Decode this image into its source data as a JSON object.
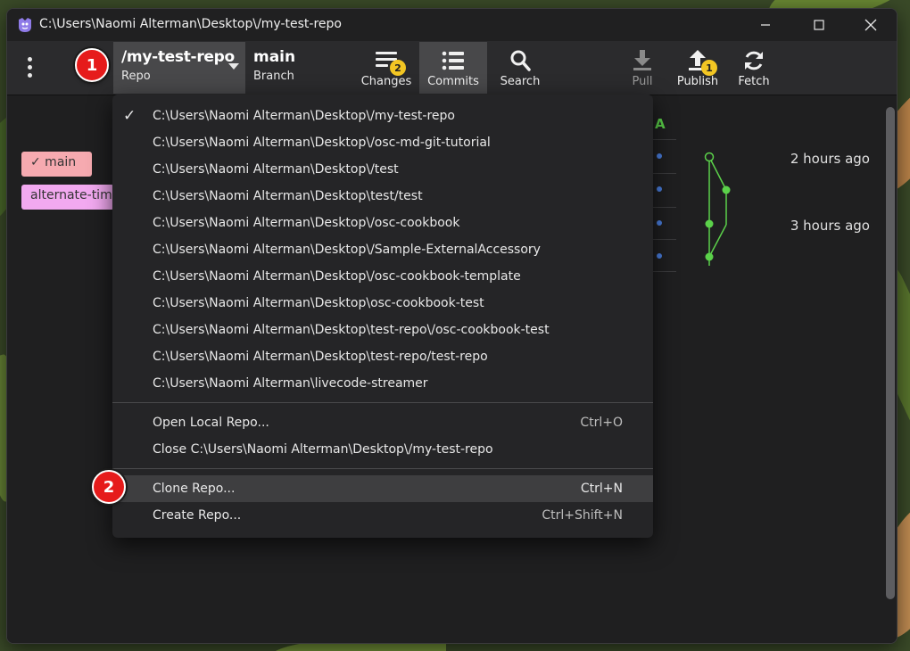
{
  "window": {
    "title": "C:\\Users\\Naomi Alterman\\Desktop\\/my-test-repo"
  },
  "toolbar": {
    "repo_name": "/my-test-repo",
    "repo_label": "Repo",
    "branch_name": "main",
    "branch_label": "Branch",
    "buttons": [
      {
        "label": "Changes",
        "icon": "changes-icon",
        "badge": "2"
      },
      {
        "label": "Commits",
        "icon": "commits-list-icon",
        "active": true
      },
      {
        "label": "Search",
        "icon": "search-icon"
      },
      {
        "label": "Pull",
        "icon": "pull-arrow-icon",
        "disabled": true
      },
      {
        "label": "Publish",
        "icon": "publish-arrow-icon",
        "badge": "1"
      },
      {
        "label": "Fetch",
        "icon": "fetch-refresh-icon"
      }
    ]
  },
  "branches": [
    {
      "label": "✓ main",
      "color": "#f6aab0"
    },
    {
      "label": "alternate-tim",
      "color": "#f2a9f0"
    }
  ],
  "graph": {
    "column_header": "A",
    "times": [
      "2 hours ago",
      "3 hours ago"
    ],
    "line_color": "#5bd14a",
    "dot_color": "#4a7fe0"
  },
  "dropdown": {
    "recent_repos": [
      "C:\\Users\\Naomi Alterman\\Desktop\\/my-test-repo",
      "C:\\Users\\Naomi Alterman\\Desktop\\/osc-md-git-tutorial",
      "C:\\Users\\Naomi Alterman\\Desktop\\/test",
      "C:\\Users\\Naomi Alterman\\Desktop\\test/test",
      "C:\\Users\\Naomi Alterman\\Desktop\\/osc-cookbook",
      "C:\\Users\\Naomi Alterman\\Desktop\\/Sample-ExternalAccessory",
      "C:\\Users\\Naomi Alterman\\Desktop\\/osc-cookbook-template",
      "C:\\Users\\Naomi Alterman\\Desktop\\osc-cookbook-test",
      "C:\\Users\\Naomi Alterman\\Desktop\\test-repo\\/osc-cookbook-test",
      "C:\\Users\\Naomi Alterman\\Desktop\\test-repo/test-repo",
      "C:\\Users\\Naomi Alterman\\livecode-streamer"
    ],
    "open_local": {
      "label": "Open Local Repo...",
      "shortcut": "Ctrl+O"
    },
    "close_repo": {
      "label": "Close C:\\Users\\Naomi Alterman\\Desktop\\/my-test-repo"
    },
    "clone_repo": {
      "label": "Clone Repo...",
      "shortcut": "Ctrl+N"
    },
    "create_repo": {
      "label": "Create Repo...",
      "shortcut": "Ctrl+Shift+N"
    }
  },
  "callouts": [
    "1",
    "2"
  ],
  "colors": {
    "callout_red": "#e61b1b",
    "badge_yellow": "#f3c623",
    "hover_bg": "#3e3e40"
  }
}
